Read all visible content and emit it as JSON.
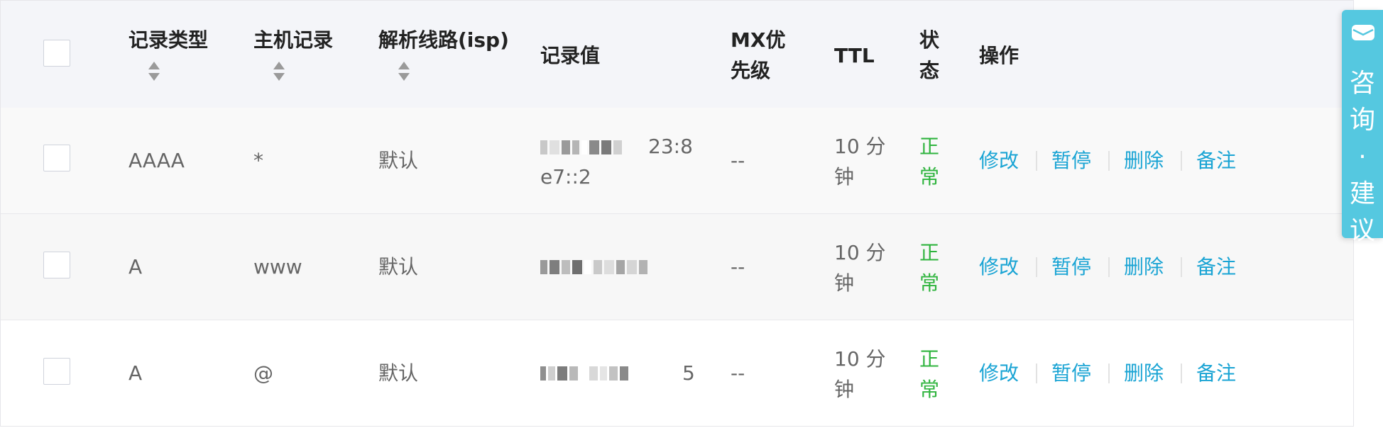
{
  "table": {
    "header": {
      "record_type": "记录类型",
      "host_record": "主机记录",
      "isp_line": "解析线路(isp)",
      "record_value": "记录值",
      "mx_line1": "MX优",
      "mx_line2": "先级",
      "ttl": "TTL",
      "status_line1": "状",
      "status_line2": "态",
      "actions": "操作"
    },
    "rows": [
      {
        "type": "AAAA",
        "host": "*",
        "line": "默认",
        "value_visible_line1": "23:8",
        "value_visible_line2": "e7::2",
        "mx": "--",
        "ttl_line1": "10 分",
        "ttl_line2": "钟",
        "status_line1": "正",
        "status_line2": "常"
      },
      {
        "type": "A",
        "host": "www",
        "line": "默认",
        "mx": "--",
        "ttl_line1": "10 分",
        "ttl_line2": "钟",
        "status_line1": "正",
        "status_line2": "常"
      },
      {
        "type": "A",
        "host": "@",
        "line": "默认",
        "value_visible_tail": "5",
        "mx": "--",
        "ttl_line1": "10 分",
        "ttl_line2": "钟",
        "status_line1": "正",
        "status_line2": "常"
      }
    ],
    "actions": {
      "modify": "修改",
      "pause": "暂停",
      "delete": "删除",
      "note": "备注"
    }
  },
  "consult": {
    "text": "咨\n询\n·\n建\n议",
    "icon": "chat-bubble-icon"
  },
  "colors": {
    "header_bg": "#f4f5f9",
    "status_ok": "#2fb43e",
    "link": "#1aa4d4",
    "consult_bg": "#55c8e0"
  }
}
